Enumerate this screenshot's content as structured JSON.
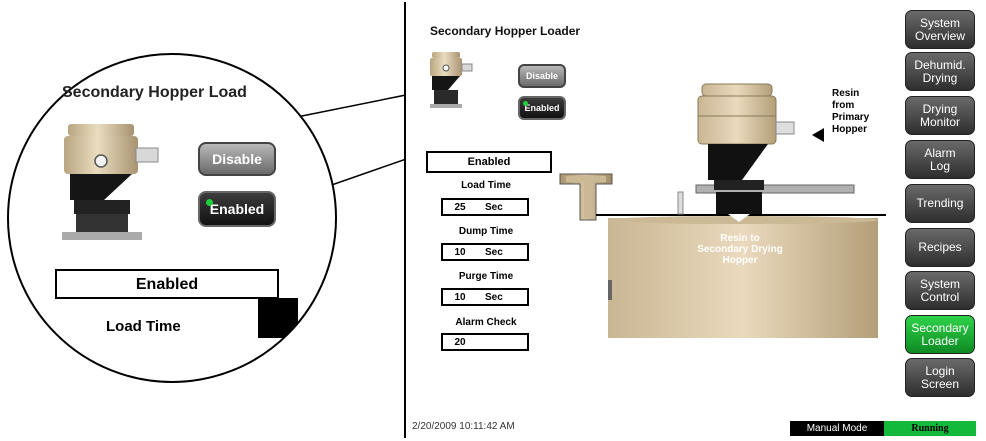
{
  "screen": {
    "title": "Secondary Hopper Loader",
    "buttons": {
      "disable": "Disable",
      "enabled": "Enabled"
    },
    "status": "Enabled",
    "fields": [
      {
        "label": "Load Time",
        "value": "25",
        "unit": "Sec"
      },
      {
        "label": "Dump Time",
        "value": "10",
        "unit": "Sec"
      },
      {
        "label": "Purge Time",
        "value": "10",
        "unit": "Sec"
      },
      {
        "label": "Alarm Check",
        "value": "20",
        "unit": ""
      }
    ],
    "diagram": {
      "resin_from": [
        "Resin",
        "from",
        "Primary",
        "Hopper"
      ],
      "resin_to": [
        "Resin to",
        "Secondary Drying",
        "Hopper"
      ]
    }
  },
  "nav": [
    {
      "line1": "System",
      "line2": "Overview",
      "active": false
    },
    {
      "line1": "Dehumid.",
      "line2": "Drying",
      "active": false
    },
    {
      "line1": "Drying",
      "line2": "Monitor",
      "active": false
    },
    {
      "line1": "Alarm",
      "line2": "Log",
      "active": false
    },
    {
      "line1": "Trending",
      "line2": "",
      "active": false
    },
    {
      "line1": "Recipes",
      "line2": "",
      "active": false
    },
    {
      "line1": "System",
      "line2": "Control",
      "active": false
    },
    {
      "line1": "Secondary",
      "line2": "Loader",
      "active": true
    },
    {
      "line1": "Login",
      "line2": "Screen",
      "active": false
    }
  ],
  "footer": {
    "datetime": "2/20/2009 10:11:42 AM",
    "mode": "Manual Mode",
    "state": "Running"
  },
  "zoom": {
    "title": "Secondary Hopper Load",
    "disable": "Disable",
    "enabled": "Enabled",
    "status": "Enabled",
    "field_label": "Load Time"
  },
  "colors": {
    "hopper": "#d8c8a8",
    "hopper_dark": "#b7a57f",
    "active_nav": "#1fbf3e",
    "running": "#13b93b"
  }
}
